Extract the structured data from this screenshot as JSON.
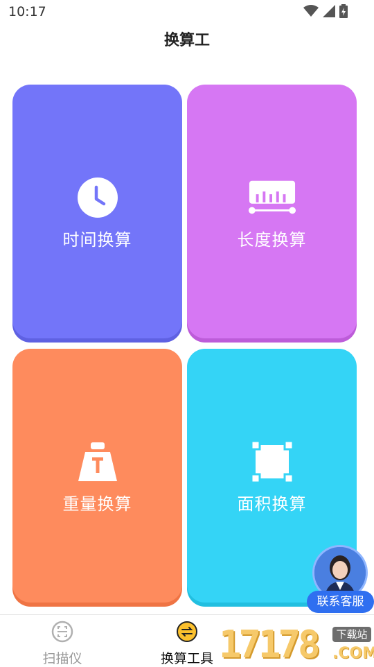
{
  "status_bar": {
    "time": "10:17"
  },
  "header": {
    "title": "换算工"
  },
  "cards": [
    {
      "label": "时间换算",
      "icon": "clock-icon",
      "color": "#7375f9"
    },
    {
      "label": "长度换算",
      "icon": "ruler-icon",
      "color": "#d677f3"
    },
    {
      "label": "重量换算",
      "icon": "weight-icon",
      "color": "#fe8b5d"
    },
    {
      "label": "面积换算",
      "icon": "area-icon",
      "color": "#34d4f6"
    }
  ],
  "customer_service": {
    "label": "联系客服"
  },
  "bottom_nav": [
    {
      "label": "扫描仪",
      "icon": "scan-icon",
      "active": false
    },
    {
      "label": "换算工具",
      "icon": "convert-icon",
      "active": true
    }
  ],
  "watermark": {
    "digits": "17178",
    "tag": "下载站",
    "suffix": ".COM"
  }
}
